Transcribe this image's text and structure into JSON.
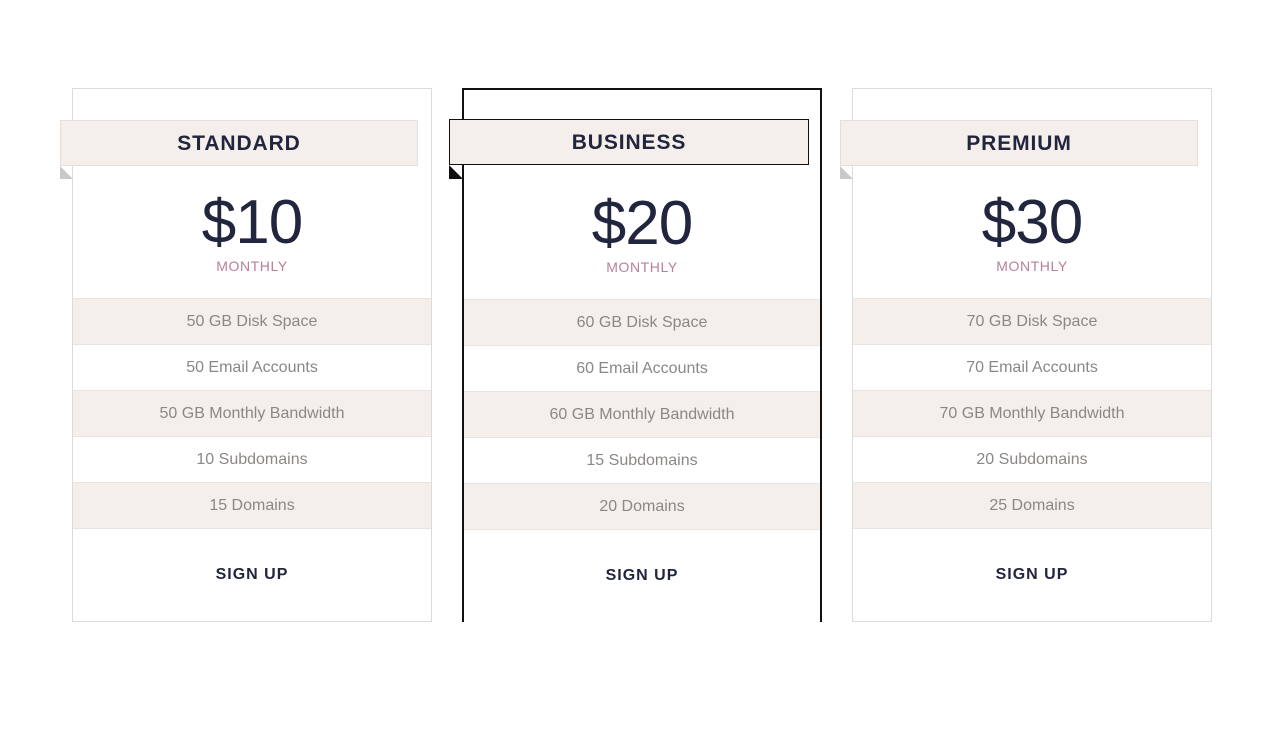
{
  "page": {
    "background": "#ffffff",
    "accent_period_color": "#b97e99",
    "heading_color": "#22253e",
    "row_alt_color": "#f5efec",
    "ribbon_color": "#f5efec"
  },
  "plans": [
    {
      "id": "standard",
      "name": "STANDARD",
      "price": "$10",
      "period": "MONTHLY",
      "featured": false,
      "features": [
        "50 GB Disk Space",
        "50 Email Accounts",
        "50 GB Monthly Bandwidth",
        "10 Subdomains",
        "15 Domains"
      ],
      "cta": "SIGN UP"
    },
    {
      "id": "business",
      "name": "BUSINESS",
      "price": "$20",
      "period": "MONTHLY",
      "featured": true,
      "features": [
        "60 GB Disk Space",
        "60 Email Accounts",
        "60 GB Monthly Bandwidth",
        "15 Subdomains",
        "20 Domains"
      ],
      "cta": "SIGN UP"
    },
    {
      "id": "premium",
      "name": "PREMIUM",
      "price": "$30",
      "period": "MONTHLY",
      "featured": false,
      "features": [
        "70 GB Disk Space",
        "70 Email Accounts",
        "70 GB Monthly Bandwidth",
        "20 Subdomains",
        "25 Domains"
      ],
      "cta": "SIGN UP"
    }
  ]
}
